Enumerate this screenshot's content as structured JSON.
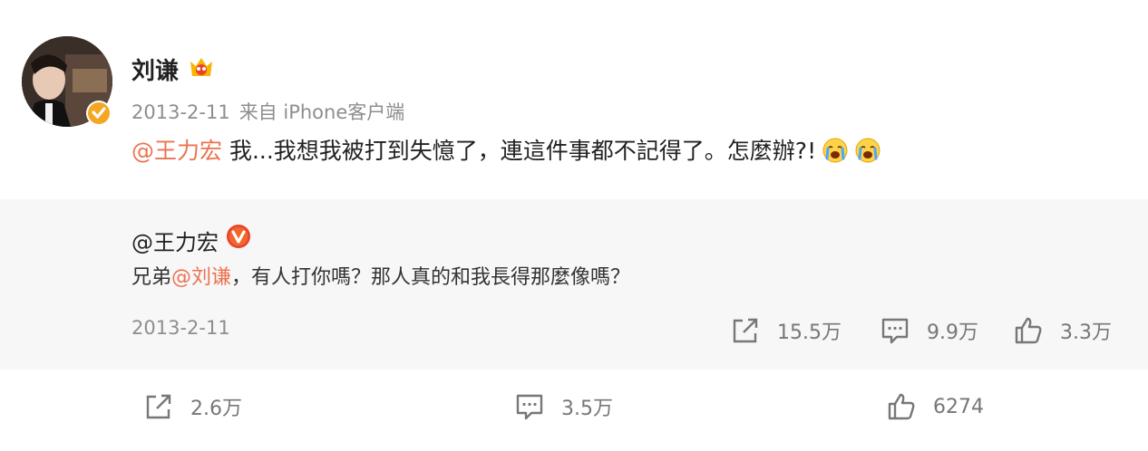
{
  "post": {
    "author": "刘谦",
    "date": "2013-2-11",
    "source": "来自 iPhone客户端",
    "mention": "@王力宏",
    "text": " 我...我想我被打到失憶了，連這件事都不記得了。怎麼辦?!"
  },
  "repost": {
    "author": "@王力宏",
    "text_prefix": "兄弟",
    "text_mention": "@刘谦",
    "text_suffix": "，有人打你嗎？那人真的和我長得那麼像嗎？",
    "date": "2013-2-11",
    "reposts": "15.5万",
    "comments": "9.9万",
    "likes": "3.3万"
  },
  "actions": {
    "reposts": "2.6万",
    "comments": "3.5万",
    "likes": "6274"
  },
  "colors": {
    "mention": "#eb7350",
    "verified": "#f5a623",
    "repost_bg": "#f7f7f7"
  },
  "icons": [
    "verified-icon",
    "crown-icon",
    "crying-emoji",
    "share-icon",
    "comment-icon",
    "like-icon"
  ]
}
